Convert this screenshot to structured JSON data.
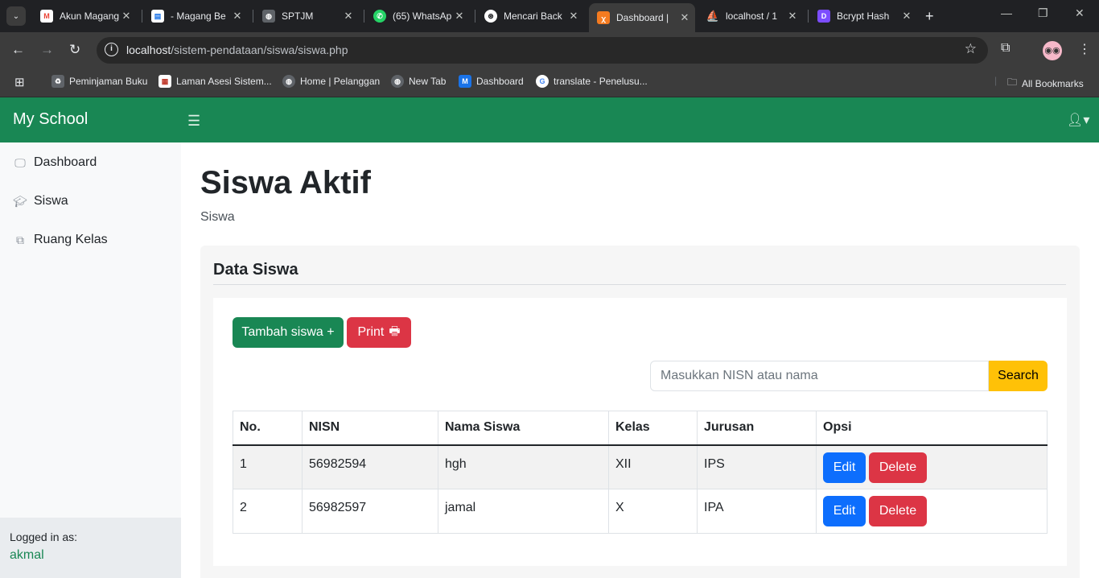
{
  "browser": {
    "tabs": [
      {
        "title": "Akun Magang",
        "favicon": "gmail-icon",
        "color": "#ea4335",
        "glyph": "M"
      },
      {
        "title": "- Magang Be",
        "favicon": "magang-icon",
        "color": "#f4b400",
        "glyph": "▤"
      },
      {
        "title": "SPTJM",
        "favicon": "globe-icon",
        "color": "#5f6368",
        "glyph": "◍"
      },
      {
        "title": "(65) WhatsAp",
        "favicon": "whatsapp-icon",
        "color": "#25d366",
        "glyph": "✆"
      },
      {
        "title": "Mencari Back",
        "favicon": "openai-icon",
        "color": "#5f6368",
        "glyph": "⊛"
      },
      {
        "title": "Dashboard |",
        "favicon": "xampp-icon",
        "color": "#f47b20",
        "glyph": "ꭓ",
        "active": true
      },
      {
        "title": "localhost / 1",
        "favicon": "phpmyadmin-icon",
        "color": "#e8a33d",
        "glyph": "⛵"
      },
      {
        "title": "Bcrypt Hash",
        "favicon": "bcrypt-icon",
        "color": "#7c4dff",
        "glyph": "D"
      }
    ],
    "url_host": "localhost",
    "url_path": "/sistem-pendataan/siswa/siswa.php",
    "bookmarks": [
      {
        "label": "Peminjaman Buku",
        "icon": "recycle-icon",
        "color": "#5f6368",
        "glyph": "♻"
      },
      {
        "label": "Laman Asesi Sistem...",
        "icon": "laman-icon",
        "color": "#ffffff",
        "glyph": "▦"
      },
      {
        "label": "Home | Pelanggan",
        "icon": "globe-icon",
        "color": "#5f6368",
        "glyph": "◍"
      },
      {
        "label": "New Tab",
        "icon": "globe-icon",
        "color": "#5f6368",
        "glyph": "◍"
      },
      {
        "label": "Dashboard",
        "icon": "m-icon",
        "color": "#1a73e8",
        "glyph": "M"
      },
      {
        "label": "translate - Penelusu...",
        "icon": "google-icon",
        "color": "#ffffff",
        "glyph": "G"
      }
    ],
    "all_bookmarks": "All Bookmarks"
  },
  "navbar": {
    "brand": "My School"
  },
  "sidebar": {
    "items": [
      {
        "label": "Dashboard",
        "icon": "monitor-icon"
      },
      {
        "label": "Siswa",
        "icon": "graduation-cap-icon"
      },
      {
        "label": "Ruang Kelas",
        "icon": "classroom-icon"
      }
    ],
    "footer_label": "Logged in as:",
    "footer_user": "akmal"
  },
  "main": {
    "title": "Siswa Aktif",
    "breadcrumb": "Siswa",
    "card_title": "Data Siswa",
    "add_button": "Tambah siswa +",
    "print_button": "Print",
    "search_placeholder": "Masukkan NISN atau nama",
    "search_button": "Search",
    "table": {
      "headers": [
        "No.",
        "NISN",
        "Nama Siswa",
        "Kelas",
        "Jurusan",
        "Opsi"
      ],
      "rows": [
        {
          "no": "1",
          "nisn": "56982594",
          "nama": "hgh",
          "kelas": "XII",
          "jurusan": "IPS"
        },
        {
          "no": "2",
          "nisn": "56982597",
          "nama": "jamal",
          "kelas": "X",
          "jurusan": "IPA"
        }
      ],
      "edit_label": "Edit",
      "delete_label": "Delete"
    }
  },
  "colors": {
    "primary": "#198754",
    "danger": "#dc3545",
    "warning": "#ffc107",
    "blue": "#0d6efd"
  }
}
